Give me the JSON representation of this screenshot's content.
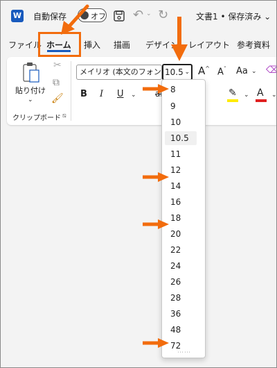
{
  "titlebar": {
    "app_icon": "W",
    "autosave_label": "自動保存",
    "autosave_state": "オフ",
    "document_title": "文書1 • 保存済み ⌄"
  },
  "tabs": [
    {
      "label": "ファイル"
    },
    {
      "label": "ホーム"
    },
    {
      "label": "挿入"
    },
    {
      "label": "描画"
    },
    {
      "label": "デザイン"
    },
    {
      "label": "レイアウト"
    },
    {
      "label": "参考資料"
    }
  ],
  "ribbon": {
    "paste_label": "貼り付け",
    "clipboard_group_label": "クリップボード",
    "font_name": "メイリオ (本文のフォン",
    "font_size": "10.5",
    "grow_font": "A",
    "shrink_font": "A",
    "change_case": "Aa",
    "bold": "B",
    "italic": "I",
    "underline": "U",
    "strikethrough": "ab",
    "highlight_color": "#ffeb00",
    "font_color": "#e02020"
  },
  "font_size_dropdown": {
    "options": [
      "8",
      "9",
      "10",
      "10.5",
      "11",
      "12",
      "14",
      "16",
      "18",
      "20",
      "22",
      "24",
      "26",
      "28",
      "36",
      "48",
      "72"
    ],
    "selected": "10.5"
  },
  "accent_colors": {
    "annotation": "#f26c0d",
    "word_blue": "#185abd"
  }
}
